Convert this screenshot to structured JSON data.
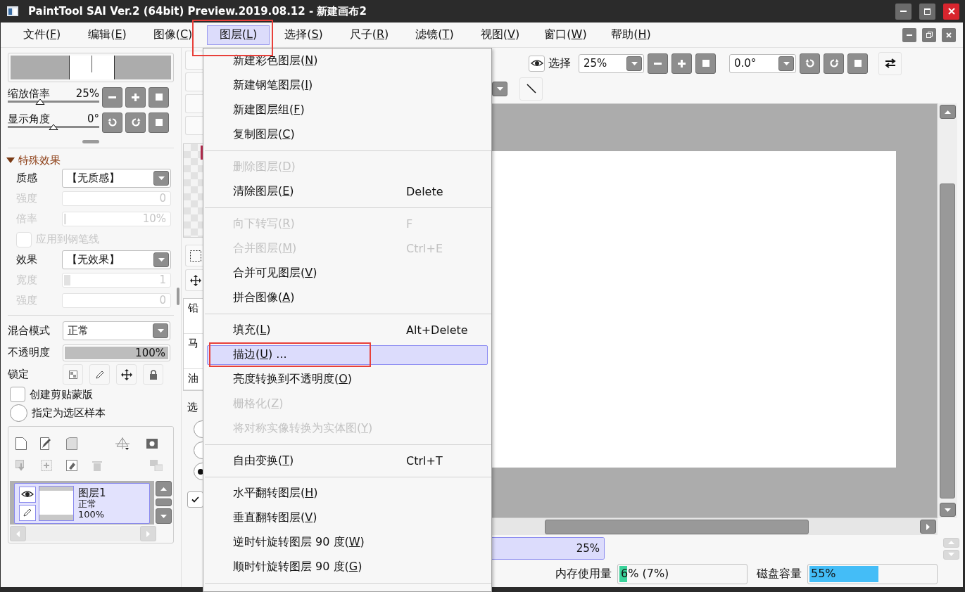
{
  "window": {
    "title": "PaintTool SAI Ver.2 (64bit) Preview.2019.08.12 - 新建画布2"
  },
  "menubar": [
    {
      "label": "文件(",
      "key": "F",
      "after": ")",
      "selected": false,
      "annotated": false
    },
    {
      "label": "编辑(",
      "key": "E",
      "after": ")",
      "selected": false,
      "annotated": false
    },
    {
      "label": "图像(",
      "key": "C",
      "after": ")",
      "selected": false,
      "annotated": false
    },
    {
      "label": "图层(",
      "key": "L",
      "after": ")",
      "selected": true,
      "annotated": true
    },
    {
      "label": "选择(",
      "key": "S",
      "after": ")",
      "selected": false,
      "annotated": false
    },
    {
      "label": "尺子(",
      "key": "R",
      "after": ")",
      "selected": false,
      "annotated": false
    },
    {
      "label": "滤镜(",
      "key": "T",
      "after": ")",
      "selected": false,
      "annotated": false
    },
    {
      "label": "视图(",
      "key": "V",
      "after": ")",
      "selected": false,
      "annotated": false
    },
    {
      "label": "窗口(",
      "key": "W",
      "after": ")",
      "selected": false,
      "annotated": false
    },
    {
      "label": "帮助(",
      "key": "H",
      "after": ")",
      "selected": false,
      "annotated": false
    }
  ],
  "menu": [
    {
      "kind": "item",
      "label": "新建彩色图层(",
      "key": "N",
      "after": ")",
      "disabled": false,
      "selected": false,
      "annotated": false
    },
    {
      "kind": "item",
      "label": "新建钢笔图层(",
      "key": "I",
      "after": ")",
      "disabled": false,
      "selected": false,
      "annotated": false
    },
    {
      "kind": "item",
      "label": "新建图层组(",
      "key": "F",
      "after": ")",
      "disabled": false,
      "selected": false,
      "annotated": false
    },
    {
      "kind": "item",
      "label": "复制图层(",
      "key": "C",
      "after": ")",
      "disabled": false,
      "selected": false,
      "annotated": false
    },
    {
      "kind": "separator"
    },
    {
      "kind": "item",
      "label": "删除图层(",
      "key": "D",
      "after": ")",
      "disabled": true,
      "selected": false,
      "annotated": false
    },
    {
      "kind": "item",
      "label": "清除图层(",
      "key": "E",
      "after": ")",
      "shortcut": "Delete",
      "disabled": false,
      "selected": false,
      "annotated": false
    },
    {
      "kind": "separator"
    },
    {
      "kind": "item",
      "label": "向下转写(",
      "key": "R",
      "after": ")",
      "shortcut": "F",
      "disabled": true,
      "selected": false,
      "annotated": false
    },
    {
      "kind": "item",
      "label": "合并图层(",
      "key": "M",
      "after": ")",
      "shortcut": "Ctrl+E",
      "disabled": true,
      "selected": false,
      "annotated": false
    },
    {
      "kind": "item",
      "label": "合并可见图层(",
      "key": "V",
      "after": ")",
      "disabled": false,
      "selected": false,
      "annotated": false
    },
    {
      "kind": "item",
      "label": "拼合图像(",
      "key": "A",
      "after": ")",
      "disabled": false,
      "selected": false,
      "annotated": false
    },
    {
      "kind": "separator"
    },
    {
      "kind": "item",
      "label": "填充(",
      "key": "L",
      "after": ")",
      "shortcut": "Alt+Delete",
      "disabled": false,
      "selected": false,
      "annotated": false
    },
    {
      "kind": "item",
      "label": "描边(",
      "key": "U",
      "after": ") ...",
      "disabled": false,
      "selected": true,
      "annotated": true
    },
    {
      "kind": "item",
      "label": "亮度转换到不透明度(",
      "key": "O",
      "after": ")",
      "disabled": false,
      "selected": false,
      "annotated": false
    },
    {
      "kind": "item",
      "label": "栅格化(",
      "key": "Z",
      "after": ")",
      "disabled": true,
      "selected": false,
      "annotated": false
    },
    {
      "kind": "item",
      "label": "将对称实像转换为实体图(",
      "key": "Y",
      "after": ")",
      "disabled": true,
      "selected": false,
      "annotated": false
    },
    {
      "kind": "separator"
    },
    {
      "kind": "item",
      "label": "自由变换(",
      "key": "T",
      "after": ")",
      "shortcut": "Ctrl+T",
      "disabled": false,
      "selected": false,
      "annotated": false
    },
    {
      "kind": "separator"
    },
    {
      "kind": "item",
      "label": "水平翻转图层(",
      "key": "H",
      "after": ")",
      "disabled": false,
      "selected": false,
      "annotated": false
    },
    {
      "kind": "item",
      "label": "垂直翻转图层(",
      "key": "V",
      "after": ")",
      "disabled": false,
      "selected": false,
      "annotated": false
    },
    {
      "kind": "item",
      "label": "逆时针旋转图层 90 度(",
      "key": "W",
      "after": ")",
      "disabled": false,
      "selected": false,
      "annotated": false
    },
    {
      "kind": "item",
      "label": "顺时针旋转图层 90 度(",
      "key": "G",
      "after": ")",
      "disabled": false,
      "selected": false,
      "annotated": false
    },
    {
      "kind": "separator"
    }
  ],
  "navigator": {
    "zoom": {
      "label": "缩放倍率",
      "value": "25%",
      "level": 0.35
    },
    "angle": {
      "label": "显示角度",
      "value": "0°",
      "level": 0.5
    }
  },
  "effects": {
    "title": "特殊效果",
    "expanded": true,
    "rows": [
      {
        "kind": "select",
        "label": "质感",
        "value": "【无质感】",
        "disabled": false
      },
      {
        "kind": "number",
        "label": "强度",
        "value": "0",
        "disabled": true
      },
      {
        "kind": "slider",
        "label": "倍率",
        "value": "10%",
        "level": 0.02,
        "disabled": true
      },
      {
        "kind": "checkbox",
        "label": "应用到钢笔线",
        "checked": false,
        "disabled": true
      },
      {
        "kind": "select",
        "label": "效果",
        "value": "【无效果】",
        "disabled": false
      },
      {
        "kind": "slider",
        "label": "宽度",
        "value": "1",
        "level": 0.06,
        "disabled": true
      },
      {
        "kind": "number",
        "label": "强度",
        "value": "0",
        "disabled": true
      }
    ]
  },
  "layer_props": {
    "blend": {
      "label": "混合模式",
      "value": "正常"
    },
    "opacity": {
      "label": "不透明度",
      "value": "100%",
      "level": 1
    },
    "lock": {
      "label": "锁定"
    },
    "clipping": {
      "label": "创建剪贴蒙版",
      "checked": false
    },
    "selection_source": {
      "label": "指定为选区样本",
      "selected": false
    }
  },
  "layers": [
    {
      "name": "图层1",
      "mode": "正常",
      "opacity": "100%",
      "selected": true,
      "visible": true
    }
  ],
  "tools": {
    "brushes": [
      "铅",
      "马",
      "油"
    ],
    "selection_label": "选",
    "radios": [
      {
        "selected": false
      },
      {
        "selected": false
      },
      {
        "selected": true
      }
    ],
    "option_checked": true
  },
  "toolbar": {
    "select_label": "选择",
    "zoom": "25%",
    "angle": "0.0°"
  },
  "navigator_bar": {
    "value": "25%"
  },
  "status": {
    "memory": {
      "label": "内存使用量",
      "value": "6% (7%)",
      "level": 0.06
    },
    "disk": {
      "label": "磁盘容量",
      "value": "55%",
      "level": 0.55
    }
  }
}
